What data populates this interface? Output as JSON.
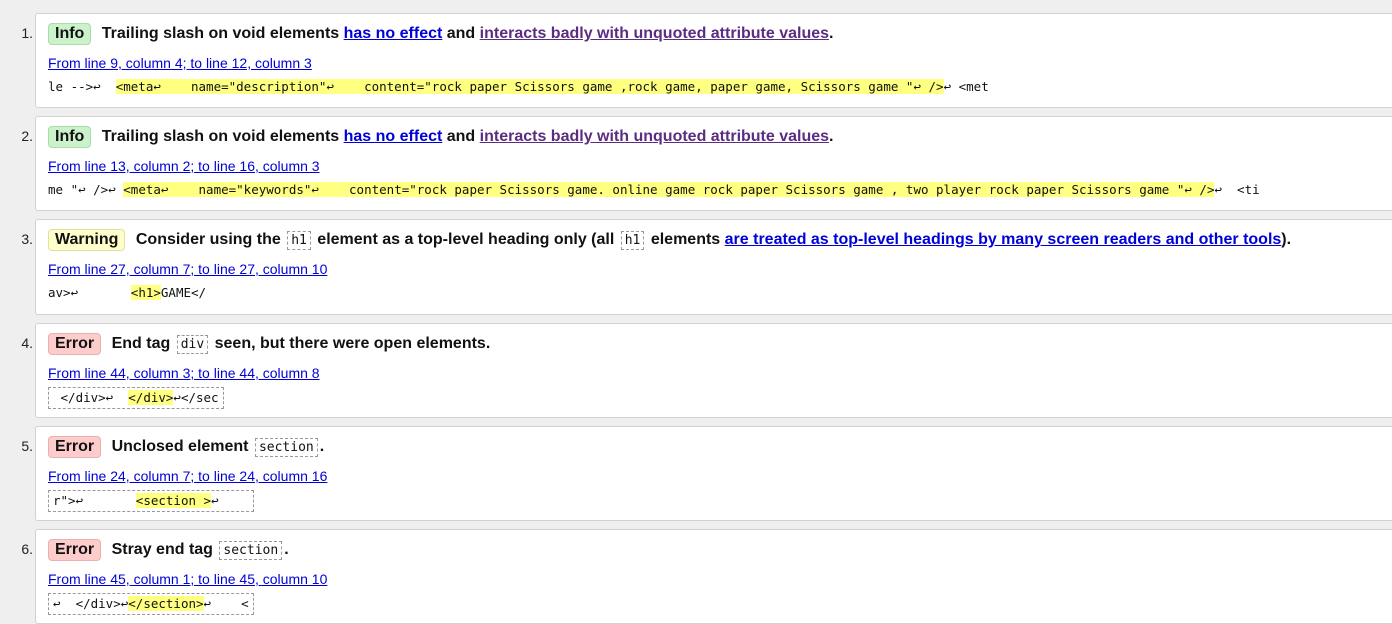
{
  "items": [
    {
      "num": "1.",
      "type": "Info",
      "msg_pre": "Trailing slash on void elements ",
      "link1": "has no effect",
      "mid": " and ",
      "link2": "interacts badly with unquoted attribute values",
      "end": ".",
      "location": "From line 9, column 4; to line 12, column 3",
      "ext_pre": "le -->↩  ",
      "ext_hl": "<meta↩    name=\"description\"↩    content=\"rock paper Scissors game ,rock game, paper game, Scissors game \"↩ />",
      "ext_post": "↩ <met"
    },
    {
      "num": "2.",
      "type": "Info",
      "msg_pre": "Trailing slash on void elements ",
      "link1": "has no effect",
      "mid": " and ",
      "link2": "interacts badly with unquoted attribute values",
      "end": ".",
      "location": "From line 13, column 2; to line 16, column 3",
      "ext_pre": "me \"↩ />↩ ",
      "ext_hl": "<meta↩    name=\"keywords\"↩    content=\"rock paper Scissors game. online game rock paper Scissors game , two player rock paper Scissors game \"↩ />",
      "ext_post": "↩  <ti"
    },
    {
      "num": "3.",
      "type": "Warning",
      "msg_a": "Consider using the ",
      "code1": "h1",
      "msg_b": " element as a top-level heading only (all ",
      "code2": "h1",
      "msg_c": " elements ",
      "link": "are treated as top-level headings by many screen readers and other tools",
      "end": ").",
      "location": "From line 27, column 7; to line 27, column 10",
      "ext_pre": "av>↩       ",
      "ext_hl": "<h1>",
      "ext_post": "GAME</"
    },
    {
      "num": "4.",
      "type": "Error",
      "msg_a": "End tag ",
      "code": "div",
      "msg_b": " seen, but there were open elements.",
      "location": "From line 44, column 3; to line 44, column 8",
      "ext_pre": " </div>↩  ",
      "ext_hl": "</div>",
      "ext_post": "↩</sec"
    },
    {
      "num": "5.",
      "type": "Error",
      "msg_a": "Unclosed element ",
      "code": "section",
      "msg_b": ".",
      "location": "From line 24, column 7; to line 24, column 16",
      "ext_pre": "r\">↩       ",
      "ext_hl": "<section >",
      "ext_post": "↩    "
    },
    {
      "num": "6.",
      "type": "Error",
      "msg_a": "Stray end tag ",
      "code": "section",
      "msg_b": ".",
      "location": "From line 45, column 1; to line 45, column 10",
      "ext_pre": "↩  </div>↩",
      "ext_hl": "</section>",
      "ext_post": "↩    <"
    }
  ]
}
